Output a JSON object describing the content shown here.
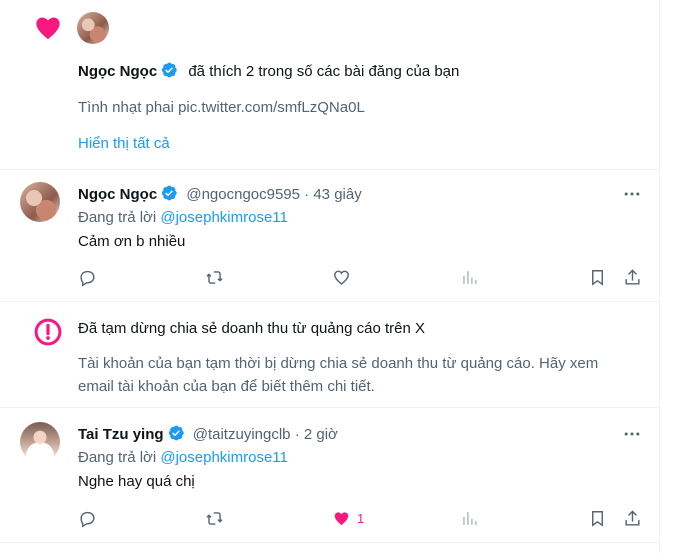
{
  "notification": {
    "user_name": "Ngọc Ngọc",
    "action_text": "đã thích 2 trong số các bài đăng của bạn",
    "post_preview": "Tình nhạt phai pic.twitter.com/smfLzQNa0L",
    "show_all_label": "Hiển thị tất cả"
  },
  "reply1": {
    "user_name": "Ngọc Ngọc",
    "handle": "@ngocngoc9595",
    "separator": "·",
    "time": "43 giây",
    "replying_prefix": "Đang trả lời",
    "replying_to": "@josephkimrose11",
    "text": "Cảm ơn b nhiều",
    "like_count": ""
  },
  "notice": {
    "title": "Đã tạm dừng chia sẻ doanh thu từ quảng cáo trên X",
    "body": "Tài khoản của bạn tạm thời bị dừng chia sẻ doanh thu từ quảng cáo. Hãy xem email tài khoản của bạn để biết thêm chi tiết."
  },
  "reply2": {
    "user_name": "Tai Tzu ying",
    "handle": "@taitzuyingclb",
    "separator": "·",
    "time": "2 giờ",
    "replying_prefix": "Đang trả lời",
    "replying_to": "@josephkimrose11",
    "text": "Nghe hay quá chị",
    "like_count": "1"
  },
  "colors": {
    "like_pink": "#f91880",
    "link_blue": "#1d9bf0",
    "verified_blue": "#1d9bf0",
    "muted_gray": "#536471"
  },
  "icons": {
    "like": "heart-icon",
    "verified": "verified-badge-icon",
    "more": "more-dots-icon",
    "reply": "reply-bubble-icon",
    "repost": "repost-icon",
    "views": "views-bars-icon",
    "bookmark": "bookmark-icon",
    "share": "share-icon",
    "alert": "alert-circle-icon"
  }
}
